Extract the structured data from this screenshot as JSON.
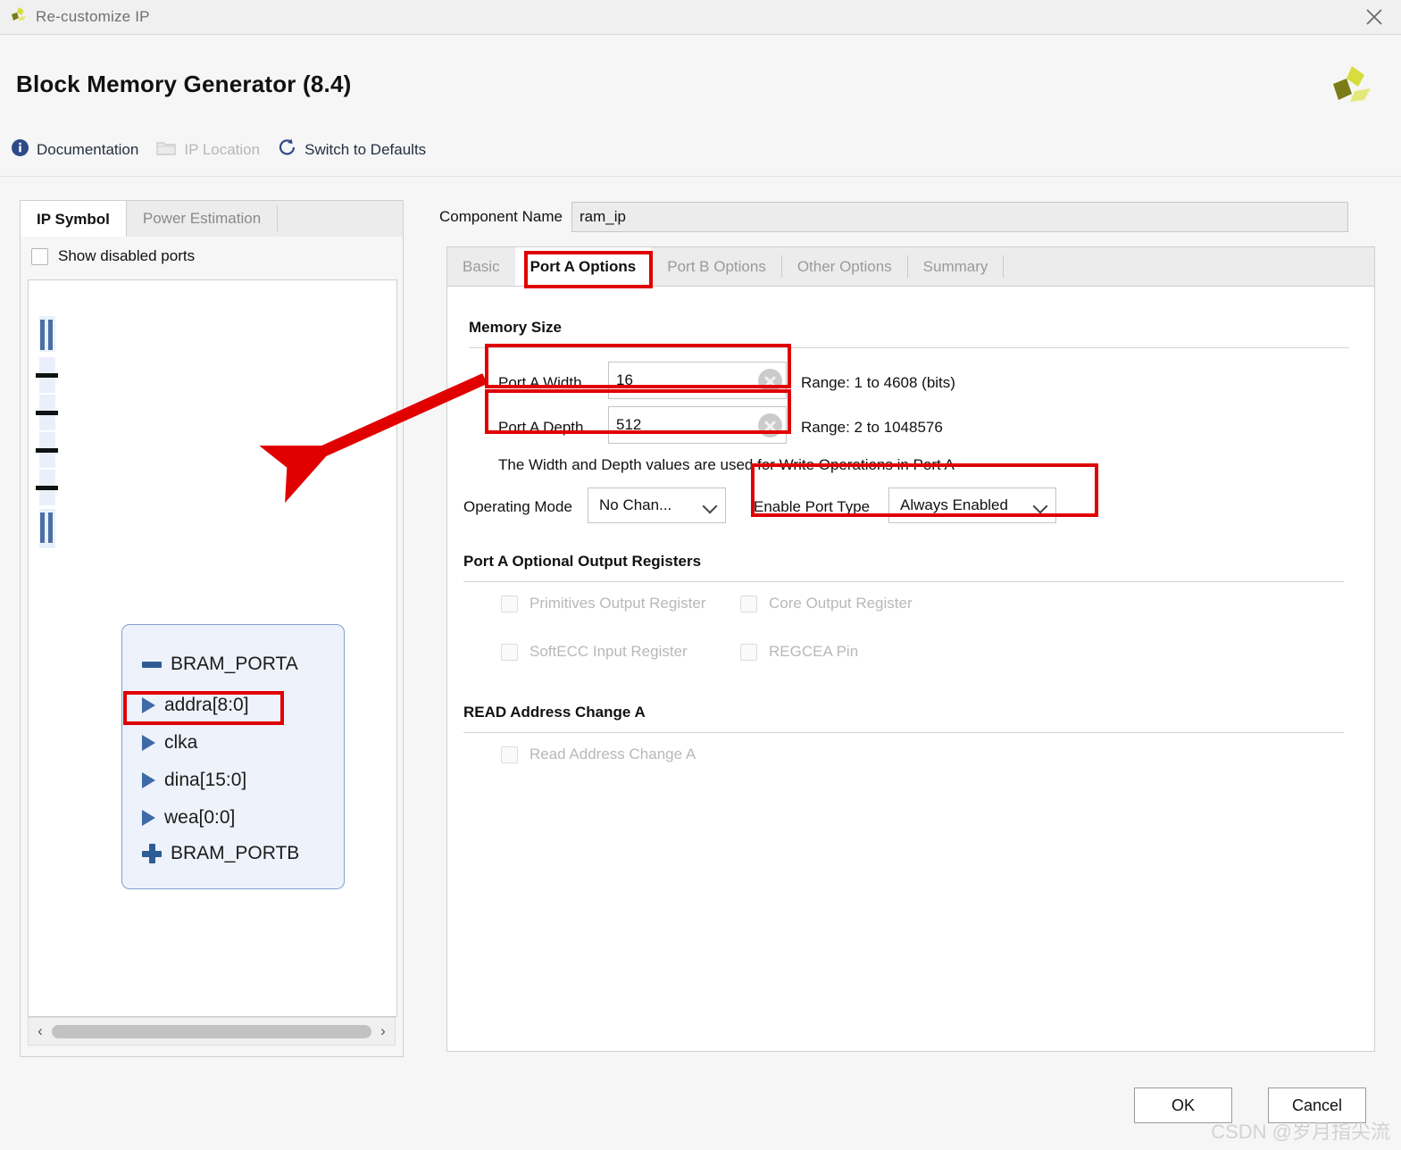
{
  "window": {
    "title": "Re-customize IP",
    "close_icon": "close-icon"
  },
  "header": {
    "ip_title": "Block Memory Generator (8.4)",
    "actions": [
      {
        "label": "Documentation",
        "icon": "info-icon",
        "enabled": true
      },
      {
        "label": "IP Location",
        "icon": "folder-icon",
        "enabled": false
      },
      {
        "label": "Switch to Defaults",
        "icon": "refresh-icon",
        "enabled": true
      }
    ],
    "vendor_logo": "xilinx-logo"
  },
  "left_panel": {
    "tabs": [
      {
        "label": "IP Symbol",
        "active": true
      },
      {
        "label": "Power Estimation",
        "active": false
      }
    ],
    "show_disabled_ports": {
      "label": "Show disabled ports",
      "checked": false
    },
    "symbol": {
      "groups": [
        {
          "label": "BRAM_PORTA",
          "expanded": true,
          "icon": "minus-icon"
        },
        {
          "label": "BRAM_PORTB",
          "expanded": false,
          "icon": "plus-icon"
        }
      ],
      "ports": [
        {
          "label": "addra[8:0]",
          "highlighted": true
        },
        {
          "label": "clka",
          "highlighted": false
        },
        {
          "label": "dina[15:0]",
          "highlighted": false
        },
        {
          "label": "wea[0:0]",
          "highlighted": false
        }
      ]
    },
    "hscrollbar": {
      "left_arrow": "‹",
      "right_arrow": "›"
    }
  },
  "right_panel": {
    "component_name": {
      "label": "Component Name",
      "value": "ram_ip"
    },
    "tabs": [
      {
        "label": "Basic",
        "active": false
      },
      {
        "label": "Port A Options",
        "active": true
      },
      {
        "label": "Port B Options",
        "active": false
      },
      {
        "label": "Other Options",
        "active": false
      },
      {
        "label": "Summary",
        "active": false
      }
    ],
    "memory_size": {
      "title": "Memory Size",
      "port_a_width": {
        "label": "Port A Width",
        "value": "16",
        "range": "Range: 1 to 4608 (bits)",
        "clear_icon": "clear-icon"
      },
      "port_a_depth": {
        "label": "Port A Depth",
        "value": "512",
        "range": "Range: 2 to 1048576",
        "clear_icon": "clear-icon"
      },
      "note": "The Width and Depth values are used for Write Operations in Port A",
      "operating_mode": {
        "label": "Operating Mode",
        "value": "No Chan...",
        "chevron": "chevron-down-icon"
      },
      "enable_port_type": {
        "label": "Enable Port Type",
        "value": "Always Enabled",
        "chevron": "chevron-down-icon"
      }
    },
    "optional_output_registers": {
      "title": "Port A Optional Output Registers",
      "checkboxes": [
        {
          "label": "Primitives Output Register",
          "checked": false,
          "disabled": true
        },
        {
          "label": "Core Output Register",
          "checked": false,
          "disabled": true
        },
        {
          "label": "SoftECC Input Register",
          "checked": false,
          "disabled": true
        },
        {
          "label": "REGCEA Pin",
          "checked": false,
          "disabled": true
        }
      ]
    },
    "read_address_change": {
      "title": "READ Address Change A",
      "checkboxes": [
        {
          "label": "Read Address Change A",
          "checked": false,
          "disabled": true
        }
      ]
    }
  },
  "footer": {
    "ok_label": "OK",
    "cancel_label": "Cancel",
    "watermark": "CSDN @岁月指尖流"
  },
  "annotation": {
    "color": "#e00000",
    "arrow": "red-arrow-annotation"
  }
}
